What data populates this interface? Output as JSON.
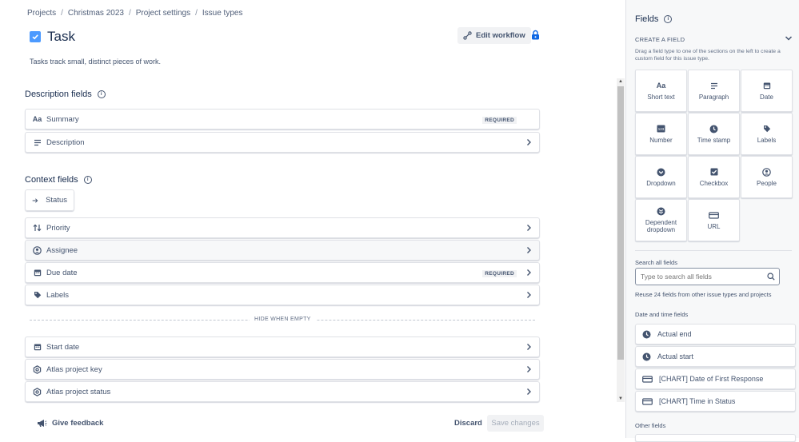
{
  "breadcrumb": [
    "Projects",
    "Christmas 2023",
    "Project settings",
    "Issue types"
  ],
  "page": {
    "title": "Task",
    "description": "Tasks track small, distinct pieces of work.",
    "edit_workflow": "Edit workflow"
  },
  "description_fields": {
    "title": "Description fields",
    "items": [
      {
        "label": "Summary",
        "badge": "REQUIRED"
      },
      {
        "label": "Description"
      }
    ]
  },
  "context_fields": {
    "title": "Context fields",
    "status": "Status",
    "items": [
      {
        "label": "Priority"
      },
      {
        "label": "Assignee"
      },
      {
        "label": "Due date",
        "badge": "REQUIRED"
      },
      {
        "label": "Labels"
      }
    ],
    "hide_when_empty": "HIDE WHEN EMPTY",
    "hidden_items": [
      {
        "label": "Start date"
      },
      {
        "label": "Atlas project key"
      },
      {
        "label": "Atlas project status"
      }
    ]
  },
  "footer": {
    "feedback": "Give feedback",
    "discard": "Discard",
    "save": "Save changes"
  },
  "sidebar": {
    "title": "Fields",
    "create_heading": "CREATE A FIELD",
    "create_hint": "Drag a field type to one of the sections on the left to create a custom field for this issue type.",
    "tiles": [
      {
        "label": "Short text",
        "icon": "short-text-icon"
      },
      {
        "label": "Paragraph",
        "icon": "paragraph-icon"
      },
      {
        "label": "Date",
        "icon": "calendar-icon"
      },
      {
        "label": "Number",
        "icon": "number-icon"
      },
      {
        "label": "Time stamp",
        "icon": "clock-icon"
      },
      {
        "label": "Labels",
        "icon": "tag-icon"
      },
      {
        "label": "Dropdown",
        "icon": "dropdown-icon"
      },
      {
        "label": "Checkbox",
        "icon": "checkbox-icon"
      },
      {
        "label": "People",
        "icon": "person-icon"
      },
      {
        "label": "Dependent dropdown",
        "icon": "dependent-dropdown-icon"
      },
      {
        "label": "URL",
        "icon": "url-icon"
      }
    ],
    "search_label": "Search all fields",
    "search_placeholder": "Type to search all fields",
    "reuse_text": "Reuse 24 fields from other issue types and projects",
    "date_group": "Date and time fields",
    "date_fields": [
      "Actual end",
      "Actual start",
      "[CHART] Date of First Response",
      "[CHART] Time in Status"
    ],
    "other_group": "Other fields"
  },
  "colors": {
    "accent": "#0c66e4",
    "check": "#4c9aff",
    "text": "#172b4d",
    "muted": "#44546f"
  }
}
